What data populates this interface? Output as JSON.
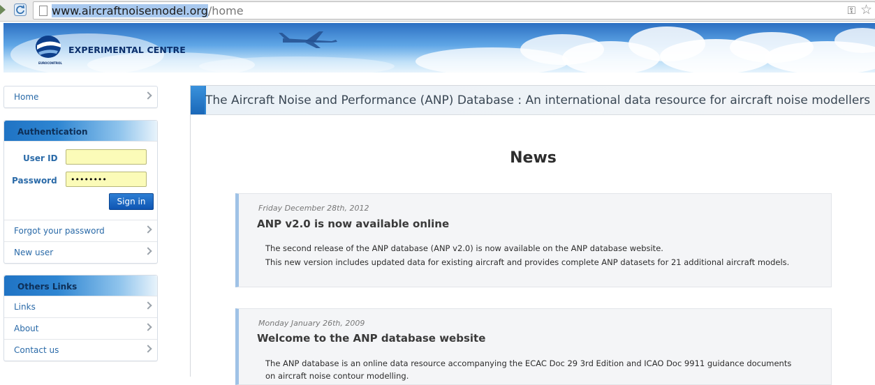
{
  "browser": {
    "url_host": "www.aircraftnoisemodel.org",
    "url_path": "/home"
  },
  "banner": {
    "logo_text": "EXPERIMENTAL CENTRE",
    "logo_subtext": "EUROCONTROL"
  },
  "sidebar": {
    "home_label": "Home",
    "auth": {
      "title": "Authentication",
      "user_id_label": "User ID",
      "user_id_value": "",
      "password_label": "Password",
      "password_value": "••••••••",
      "signin_label": "Sign in",
      "forgot_label": "Forgot your password",
      "new_user_label": "New user"
    },
    "links": {
      "title": "Others Links",
      "items": [
        "Links",
        "About",
        "Contact us"
      ]
    }
  },
  "main": {
    "header_title": "The Aircraft Noise and Performance (ANP) Database : An international data resource for aircraft noise modellers",
    "news_title": "News",
    "news": [
      {
        "date": "Friday December 28th, 2012",
        "headline": "ANP v2.0 is now available online",
        "lines": [
          "The second release of the ANP database (ANP v2.0) is now available on the ANP database website.",
          "This new version includes updated data for existing aircraft and provides complete ANP datasets for 21 additional aircraft models."
        ]
      },
      {
        "date": "Monday January 26th, 2009",
        "headline": "Welcome to the ANP database website",
        "lines": [
          "The ANP database is an online data resource accompanying the ECAC Doc 29 3rd Edition and ICAO Doc 9911 guidance documents",
          "on aircraft noise contour modelling."
        ]
      }
    ]
  }
}
